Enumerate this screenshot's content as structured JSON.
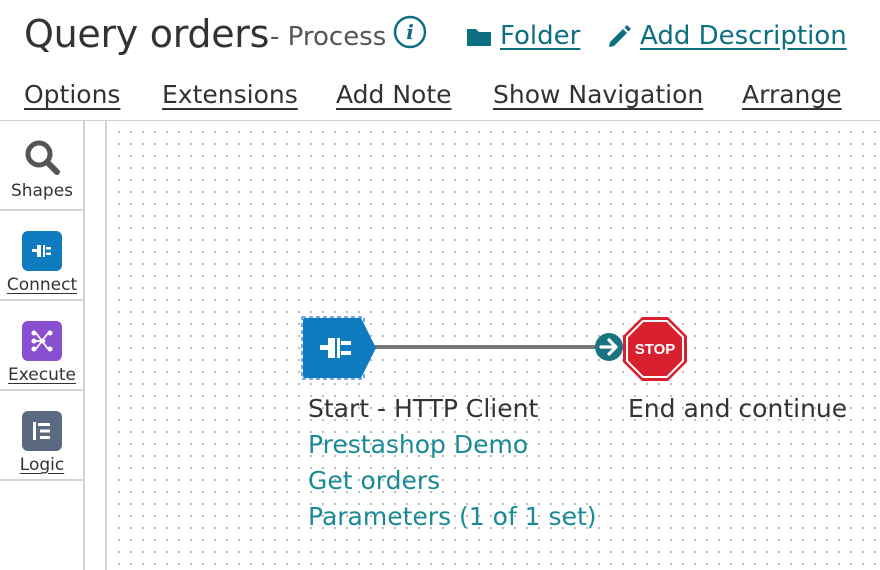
{
  "header": {
    "title": "Query orders",
    "subtitle": "- Process",
    "folder_label": "Folder",
    "add_description_label": "Add Description"
  },
  "menu": {
    "options": "Options",
    "extensions": "Extensions",
    "add_note": "Add Note",
    "show_navigation": "Show Navigation",
    "arrange": "Arrange"
  },
  "palette": {
    "items": [
      {
        "label": "Shapes",
        "icon": "search-icon"
      },
      {
        "label": "Connect",
        "icon": "plug-icon",
        "color": "#0f7bbf"
      },
      {
        "label": "Execute",
        "icon": "flow-icon",
        "color": "#8a4fd1"
      },
      {
        "label": "Logic",
        "icon": "list-icon",
        "color": "#5b6a80"
      }
    ]
  },
  "canvas": {
    "start_shape": {
      "title": "Start - HTTP Client",
      "connection": "Prestashop Demo",
      "operation": "Get orders",
      "parameters": "Parameters (1 of 1 set)",
      "color": "#0f7bbf"
    },
    "stop_shape": {
      "icon_text": "STOP",
      "title": "End and continue",
      "color": "#d8202f"
    }
  },
  "colors": {
    "link": "#0e6e82",
    "teal_text": "#1a8a96",
    "arrow": "#1a7480"
  }
}
